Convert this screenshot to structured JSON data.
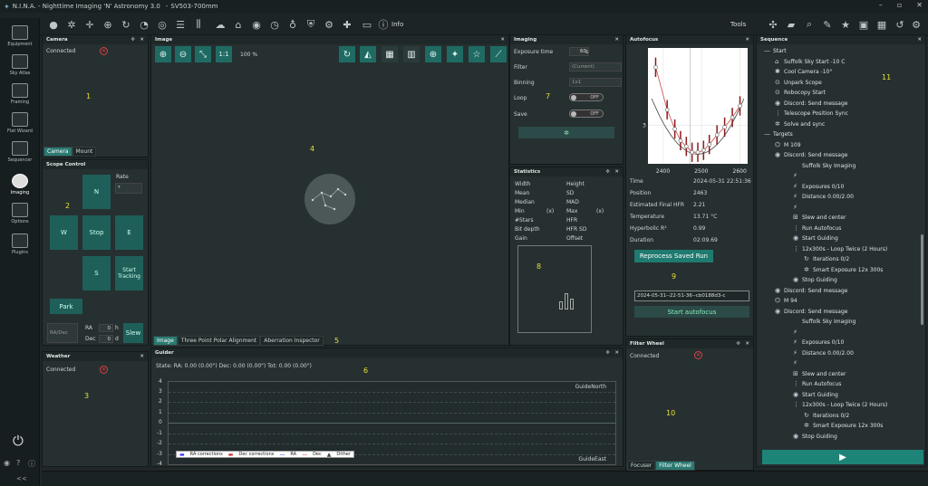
{
  "title": {
    "app": "N.I.N.A. - Nighttime Imaging 'N' Astronomy 3.0",
    "profile": "SV503-700mm"
  },
  "toolbar": {
    "info": "Info",
    "tools": "Tools"
  },
  "nav": [
    {
      "label": "Equipment"
    },
    {
      "label": "Sky Atlas"
    },
    {
      "label": "Framing"
    },
    {
      "label": "Flat Wizard"
    },
    {
      "label": "Sequencer"
    },
    {
      "label": "Imaging"
    },
    {
      "label": "Options"
    },
    {
      "label": "Plugins"
    }
  ],
  "camera": {
    "title": "Camera",
    "status": "Connected",
    "tab1": "Camera",
    "tab2": "Mount",
    "num": "1"
  },
  "scope": {
    "title": "Scope Control",
    "rate": "Rate",
    "n": "N",
    "w": "W",
    "stop": "Stop",
    "e": "E",
    "s": "S",
    "tracking": "Start Tracking",
    "park": "Park",
    "radec": "RA/Dec",
    "ra": "RA",
    "dec": "Dec",
    "ra_val": "0",
    "ra_unit": "h",
    "dec_val": "0",
    "dec_unit": "d",
    "slew": "Slew",
    "num": "2"
  },
  "weather": {
    "title": "Weather",
    "status": "Connected",
    "num": "3"
  },
  "image": {
    "title": "Image",
    "zoom_label": "1:1",
    "zoom": "100 %",
    "num": "4",
    "tabs": [
      "Image",
      "Three Point Polar Alignment",
      "Aberration Inspector"
    ],
    "tabnum": "5"
  },
  "guider": {
    "title": "Guider",
    "state": "State:  RA: 0.00 (0.00\")  Dec: 0.00 (0.00\")  Tot: 0.00 (0.00\")",
    "num": "6",
    "yticks": [
      "4",
      "3",
      "2",
      "1",
      "0",
      "-1",
      "-2",
      "-3",
      "-4"
    ],
    "north": "GuideNorth",
    "east": "GuideEast",
    "legend": [
      "RA corrections",
      "Dec corrections",
      "RA",
      "Dec",
      "Dither"
    ]
  },
  "imaging": {
    "title": "Imaging",
    "exposure_label": "Exposure time",
    "exposure": "60",
    "exposure_unit": "s",
    "filter_label": "Filter",
    "filter": "(Current)",
    "binning_label": "Binning",
    "binning": "1x1",
    "loop_label": "Loop",
    "loop": "OFF",
    "save_label": "Save",
    "save": "OFF",
    "num": "7"
  },
  "statistics": {
    "title": "Statistics",
    "rows": [
      [
        "Width",
        "",
        "Height"
      ],
      [
        "Mean",
        "",
        "SD"
      ],
      [
        "Median",
        "",
        "MAD"
      ],
      [
        "Min",
        "(x)",
        "Max",
        "(x)"
      ],
      [
        "#Stars",
        "",
        "HFR"
      ],
      [
        "Bit depth",
        "",
        "HFR SD"
      ],
      [
        "Gain",
        "",
        "Offset"
      ]
    ],
    "num": "8"
  },
  "autofocus": {
    "title": "Autofocus",
    "ytick": "3",
    "xticks": [
      "2400",
      "2500",
      "2600"
    ],
    "time_label": "Time",
    "time": "2024-05-31 22:51:36",
    "position_label": "Position",
    "position": "2463",
    "hfr_label": "Estimated Final HFR",
    "hfr": "2.21",
    "temp_label": "Temperature",
    "temp": "13.71 °C",
    "hyp_label": "Hyperbolic R²",
    "hyp": "0.99",
    "dur_label": "Duration",
    "dur": "02:09.69",
    "reprocess": "Reprocess Saved Run",
    "num": "9",
    "run": "2024-05-31--22-51-36--cb0188d3-c",
    "start": "Start autofocus",
    "chart_data": {
      "type": "scatter",
      "x": [
        2380,
        2410,
        2430,
        2445,
        2460,
        2475,
        2490,
        2505,
        2520,
        2540,
        2560,
        2580,
        2600
      ],
      "y": [
        4.5,
        3.4,
        2.9,
        2.6,
        2.45,
        2.3,
        2.3,
        2.35,
        2.5,
        2.75,
        2.95,
        3.2,
        3.5
      ],
      "xlabel": "",
      "ylabel": "",
      "xlim": [
        2360,
        2620
      ],
      "ylim": [
        2,
        5
      ]
    }
  },
  "filterwheel": {
    "title": "Filter Wheel",
    "status": "Connected",
    "num": "10",
    "tab1": "Focuser",
    "tab2": "Filter Wheel"
  },
  "sequence": {
    "title": "Sequence",
    "num": "11",
    "items": [
      {
        "t": "Start",
        "lvl": 0,
        "ic": "—"
      },
      {
        "t": "Suffolk Sky Start -10 C",
        "lvl": 1,
        "ic": "⌂"
      },
      {
        "t": "Cool Camera  -10°",
        "lvl": 1,
        "ic": "✱"
      },
      {
        "t": "Unpark Scope",
        "lvl": 1,
        "ic": "⊙"
      },
      {
        "t": "Robocopy Start",
        "lvl": 1,
        "ic": "⊙"
      },
      {
        "t": "Discord: Send message",
        "lvl": 1,
        "ic": "◉"
      },
      {
        "t": "Telescope Position Sync",
        "lvl": 1,
        "ic": "⋮"
      },
      {
        "t": "Solve and sync",
        "lvl": 1,
        "ic": "✲"
      },
      {
        "t": "Targets",
        "lvl": 0,
        "ic": "—"
      },
      {
        "t": "M 109",
        "lvl": 1,
        "ic": "⌬"
      },
      {
        "t": "Discord: Send message",
        "lvl": 1,
        "ic": "◉"
      },
      {
        "t": "Suffolk Sky Imaging",
        "lvl": 2,
        "ic": ""
      },
      {
        "t": "",
        "lvl": 2,
        "ic": "⚡"
      },
      {
        "t": "Exposures 0/10",
        "lvl": 2,
        "ic": "⚡"
      },
      {
        "t": "Distance  0.00/2.00",
        "lvl": 2,
        "ic": "⚡"
      },
      {
        "t": "",
        "lvl": 2,
        "ic": "⚡"
      },
      {
        "t": "Slew and center",
        "lvl": 2,
        "ic": "⊞"
      },
      {
        "t": "Run Autofocus",
        "lvl": 2,
        "ic": "⋮"
      },
      {
        "t": "Start Guiding",
        "lvl": 2,
        "ic": "◉"
      },
      {
        "t": "12x300s - Loop Twice (2 Hours)",
        "lvl": 2,
        "ic": "⋮"
      },
      {
        "t": "Iterations  0/2",
        "lvl": 3,
        "ic": "↻"
      },
      {
        "t": "Smart Exposure  12x   300s",
        "lvl": 3,
        "ic": "✲"
      },
      {
        "t": "Stop Guiding",
        "lvl": 2,
        "ic": "◉"
      },
      {
        "t": "Discord: Send message",
        "lvl": 1,
        "ic": "◉"
      },
      {
        "t": "M 94",
        "lvl": 1,
        "ic": "⌬"
      },
      {
        "t": "Discord: Send message",
        "lvl": 1,
        "ic": "◉"
      },
      {
        "t": "Suffolk Sky Imaging",
        "lvl": 2,
        "ic": ""
      },
      {
        "t": "",
        "lvl": 2,
        "ic": "⚡"
      },
      {
        "t": "Exposures 0/10",
        "lvl": 2,
        "ic": "⚡"
      },
      {
        "t": "Distance  0.00/2.00",
        "lvl": 2,
        "ic": "⚡"
      },
      {
        "t": "",
        "lvl": 2,
        "ic": "⚡"
      },
      {
        "t": "Slew and center",
        "lvl": 2,
        "ic": "⊞"
      },
      {
        "t": "Run Autofocus",
        "lvl": 2,
        "ic": "⋮"
      },
      {
        "t": "Start Guiding",
        "lvl": 2,
        "ic": "◉"
      },
      {
        "t": "12x300s - Loop Twice (2 Hours)",
        "lvl": 2,
        "ic": "⋮"
      },
      {
        "t": "Iterations  0/2",
        "lvl": 3,
        "ic": "↻"
      },
      {
        "t": "Smart Exposure  12x   300s",
        "lvl": 3,
        "ic": "✲"
      },
      {
        "t": "Stop Guiding",
        "lvl": 2,
        "ic": "◉"
      }
    ]
  },
  "colors": {
    "accent": "#1f6b64",
    "panel": "#263031",
    "bg": "#1f2728",
    "red": "#e04040",
    "yellow": "#e6e039"
  }
}
